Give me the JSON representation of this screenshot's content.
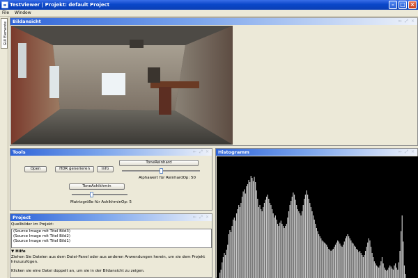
{
  "window": {
    "title": "TestViewer | Projekt: default Project",
    "min_icon": "minimize-icon",
    "max_icon": "maximize-icon",
    "close_icon": "close-icon"
  },
  "menubar": {
    "items": [
      "File",
      "Window"
    ]
  },
  "sidetab": {
    "label": "GUI Elemente"
  },
  "panels": {
    "bildansicht": {
      "title": "Bildansicht"
    },
    "tools": {
      "title": "Tools"
    },
    "project": {
      "title": "Project"
    },
    "histogramm": {
      "title": "Histogramm"
    }
  },
  "panel_controls": [
    "restore-icon",
    "maximize-icon",
    "close-icon"
  ],
  "tools": {
    "open": "Open",
    "hdr": "HDR generieren",
    "info": "Info",
    "reinhard_button": "ToneReinhard",
    "reinhard_slider_label": "Alphawert für ReinhardOp: 50",
    "reinhard_value": 50,
    "ashikhmin_button": "ToneAshikhmin",
    "ashikhmin_slider_label": "Matrixgröße für AshikhminOp: 5",
    "ashikhmin_value": 5
  },
  "project": {
    "quellbilder_label": "Quellbilder im Projekt:",
    "items": [
      "(Source Image mit Titel Bild3)",
      "(Source Image mit Titel Bild2)",
      "(Source Image mit Titel Bild1)"
    ],
    "hilfe_label": "▼ Hilfe",
    "hilfe_text1": "Ziehen Sie Dateien aus dem Datei-Panel oder aus anderen Anwendungen herein, um sie dem Projekt",
    "hilfe_text1b": "hinzuzufügen.",
    "hilfe_text2": "Klicken sie eine Datei doppelt an, um sie in der Bildansicht zu zeigen."
  },
  "histogram": {
    "color": "#c8c8c8",
    "background": "#000000",
    "bins": [
      0.05,
      0.08,
      0.15,
      0.2,
      0.24,
      0.22,
      0.27,
      0.32,
      0.42,
      0.46,
      0.44,
      0.5,
      0.56,
      0.58,
      0.55,
      0.62,
      0.66,
      0.7,
      0.68,
      0.72,
      0.78,
      0.83,
      0.85,
      0.81,
      0.88,
      0.9,
      0.94,
      0.92,
      0.98,
      0.96,
      0.93,
      0.97,
      0.92,
      0.84,
      0.76,
      0.68,
      0.7,
      0.66,
      0.64,
      0.68,
      0.72,
      0.75,
      0.78,
      0.8,
      0.76,
      0.72,
      0.7,
      0.66,
      0.62,
      0.58,
      0.6,
      0.56,
      0.52,
      0.5,
      0.53,
      0.55,
      0.52,
      0.5,
      0.48,
      0.5,
      0.52,
      0.58,
      0.64,
      0.7,
      0.74,
      0.78,
      0.82,
      0.8,
      0.75,
      0.7,
      0.66,
      0.64,
      0.62,
      0.6,
      0.64,
      0.7,
      0.76,
      0.8,
      0.84,
      0.8,
      0.76,
      0.72,
      0.68,
      0.64,
      0.6,
      0.56,
      0.52,
      0.48,
      0.45,
      0.42,
      0.4,
      0.38,
      0.36,
      0.35,
      0.34,
      0.33,
      0.32,
      0.3,
      0.28,
      0.27,
      0.26,
      0.27,
      0.28,
      0.3,
      0.32,
      0.34,
      0.36,
      0.35,
      0.33,
      0.31,
      0.3,
      0.32,
      0.35,
      0.38,
      0.4,
      0.42,
      0.4,
      0.38,
      0.36,
      0.34,
      0.33,
      0.31,
      0.3,
      0.28,
      0.27,
      0.25,
      0.26,
      0.24,
      0.22,
      0.2,
      0.22,
      0.26,
      0.3,
      0.34,
      0.38,
      0.36,
      0.3,
      0.24,
      0.2,
      0.16,
      0.14,
      0.12,
      0.11,
      0.1,
      0.12,
      0.16,
      0.2,
      0.14,
      0.1,
      0.08,
      0.07,
      0.08,
      0.1,
      0.12,
      0.11,
      0.09,
      0.08,
      0.12,
      0.14,
      0.1,
      0.08,
      0.15,
      0.26,
      0.45,
      0.6,
      0.35,
      0.12,
      0.04
    ]
  }
}
